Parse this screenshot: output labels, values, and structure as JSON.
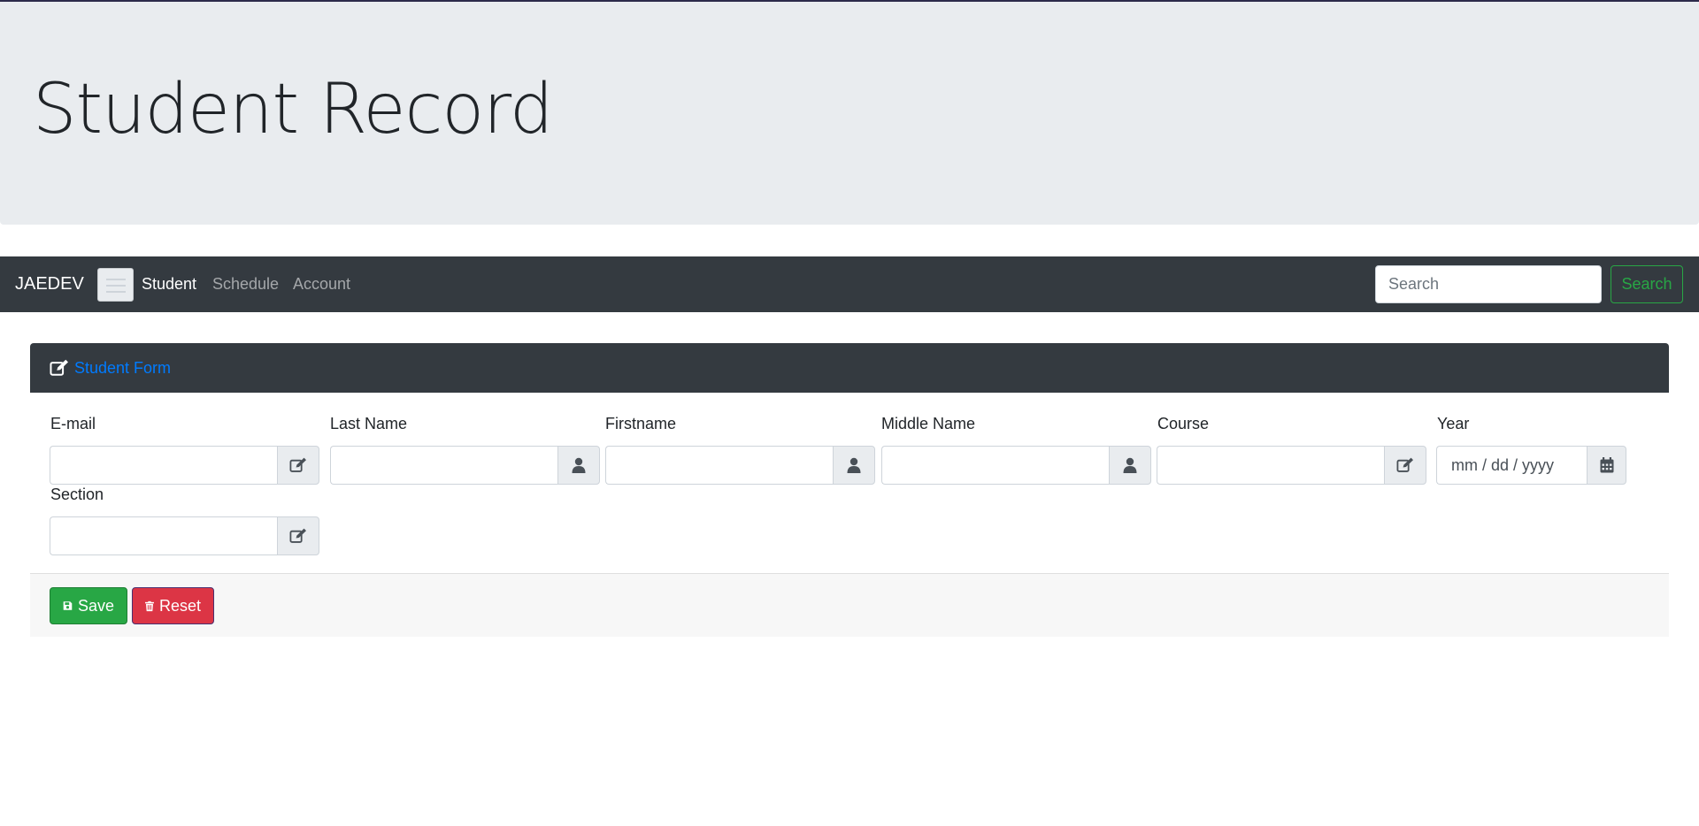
{
  "header": {
    "title": "Student Record"
  },
  "navbar": {
    "brand": "JAEDEV",
    "links": [
      {
        "label": "Student",
        "active": true
      },
      {
        "label": "Schedule",
        "active": false
      },
      {
        "label": "Account",
        "active": false
      }
    ],
    "search_placeholder": "Search",
    "search_button": "Search"
  },
  "form": {
    "title": "Student Form",
    "fields": [
      {
        "label": "E-mail",
        "value": "",
        "placeholder": "",
        "icon": "edit-icon"
      },
      {
        "label": "Last Name",
        "value": "",
        "placeholder": "",
        "icon": "user-icon"
      },
      {
        "label": "Firstname",
        "value": "",
        "placeholder": "",
        "icon": "user-icon"
      },
      {
        "label": "Middle Name",
        "value": "",
        "placeholder": "",
        "icon": "user-icon"
      },
      {
        "label": "Course",
        "value": "",
        "placeholder": "",
        "icon": "edit-icon"
      },
      {
        "label": "Year",
        "value": "",
        "placeholder": "mm / dd / yyyy",
        "icon": "calendar-icon"
      },
      {
        "label": "Section",
        "value": "",
        "placeholder": "",
        "icon": "edit-icon"
      }
    ],
    "save_label": "Save",
    "reset_label": "Reset"
  },
  "colors": {
    "navbar_bg": "#343a40",
    "jumbotron_bg": "#e9ecef",
    "link_blue": "#007bff",
    "success": "#28a745",
    "danger": "#dc3545"
  }
}
